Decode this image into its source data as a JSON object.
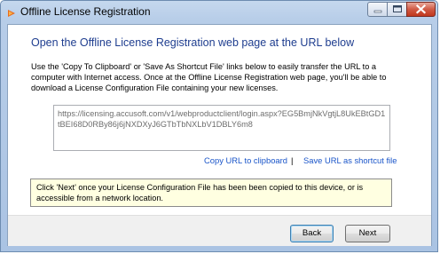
{
  "window": {
    "title": "Offline License Registration"
  },
  "main": {
    "heading": "Open the Offline License Registration web page at the URL below",
    "instructions": "Use the 'Copy To Clipboard' or 'Save As Shortcut File' links below to easily transfer the URL to a computer with Internet access. Once at the Offline License Registration web page, you'll be able to download a License Configuration File containing your new licenses.",
    "url": "https://licensing.accusoft.com/v1/webproductclient/login.aspx?EG5BmjNkVgtjL8UkEBtGD1tBEI68D0RBy86j6jNXDXyJ6GTbTbNXLbV1DBLY6m8",
    "copy_link": "Copy URL to clipboard",
    "separator": "|",
    "save_link": "Save URL as shortcut file",
    "note": "Click 'Next' once your License Configuration File has been been copied to this device, or is accessible from a network location."
  },
  "footer": {
    "back_label": "Back",
    "next_label": "Next"
  },
  "colors": {
    "heading": "#1e3d8f",
    "link": "#1a55c9",
    "note_background": "#ffffe1"
  },
  "icons": {
    "app": "app-icon",
    "minimize": "minimize-icon",
    "maximize": "maximize-icon",
    "close": "close-icon"
  }
}
